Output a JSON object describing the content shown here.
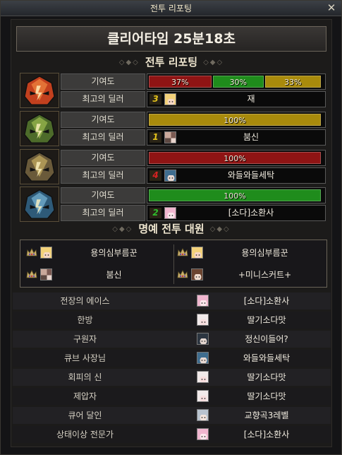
{
  "window": {
    "title": "전투 리포팅",
    "close_icon": "✕"
  },
  "clear_time": "클리어타임  25분18초",
  "report_header": "전투 리포팅",
  "labels": {
    "contribution": "기여도",
    "top_dealer": "최고의 딜러"
  },
  "stages": [
    {
      "icon": "red-helmet-icon",
      "contribution": [
        {
          "label": "37%",
          "value": 37,
          "color": "#8f1414"
        },
        {
          "label": "30%",
          "value": 30,
          "color": "#1f8c1c"
        },
        {
          "label": "33%",
          "value": 33,
          "color": "#a88a0c"
        }
      ],
      "dealer": {
        "rank": "3",
        "rank_color": "#e3c21b",
        "avatar": "blonde-avatar-icon",
        "name": "재"
      }
    },
    {
      "icon": "green-helmet-icon",
      "contribution": [
        {
          "label": "100%",
          "value": 100,
          "color": "#a88a0c"
        }
      ],
      "dealer": {
        "rank": "1",
        "rank_color": "#e3c21b",
        "avatar": "mosaic-avatar-icon",
        "name": "붐신"
      }
    },
    {
      "icon": "gold-helmet-icon",
      "contribution": [
        {
          "label": "100%",
          "value": 100,
          "color": "#8f1414"
        }
      ],
      "dealer": {
        "rank": "4",
        "rank_color": "#d72222",
        "avatar": "blue-hair-avatar-icon",
        "name": "와들와들세탁"
      }
    },
    {
      "icon": "blue-helmet-icon",
      "contribution": [
        {
          "label": "100%",
          "value": 100,
          "color": "#1f8c1c"
        }
      ],
      "dealer": {
        "rank": "2",
        "rank_color": "#2fbd2c",
        "avatar": "pink-hair-avatar-icon",
        "name": "[소다]소환사"
      }
    }
  ],
  "honor_header": "명예 전투 대원",
  "honor_members": [
    {
      "name": "용의심부름꾼",
      "avatar": "blonde-avatar-icon"
    },
    {
      "name": "용의심부름꾼",
      "avatar": "blonde-avatar-icon"
    },
    {
      "name": "붐신",
      "avatar": "mosaic-avatar-icon"
    },
    {
      "name": "+미니스커트+",
      "avatar": "brown-hair-avatar-icon"
    }
  ],
  "awards": [
    {
      "title": "전장의 에이스",
      "name": "[소다]소환사",
      "avatar": "pink-hair-avatar-icon"
    },
    {
      "title": "한방",
      "name": "딸기소다맛",
      "avatar": "white-hair-avatar-icon"
    },
    {
      "title": "구원자",
      "name": "정신이들어?",
      "avatar": "dark-hair-avatar-icon"
    },
    {
      "title": "큐브 사장님",
      "name": "와들와들세탁",
      "avatar": "blue-hair-avatar-icon"
    },
    {
      "title": "회피의 신",
      "name": "딸기소다맛",
      "avatar": "white-hair-avatar-icon"
    },
    {
      "title": "제압자",
      "name": "딸기소다맛",
      "avatar": "white-hair-avatar-icon"
    },
    {
      "title": "큐어 달인",
      "name": "교향곡3레벨",
      "avatar": "silver-hair-avatar-icon"
    },
    {
      "title": "상태이상 전문가",
      "name": "[소다]소환사",
      "avatar": "pink-hair-avatar-icon"
    }
  ],
  "colors": {
    "frame_border": "#6a6458",
    "text": "#efe9dc",
    "gold": "#a88a0c",
    "red": "#8f1414",
    "green": "#1f8c1c"
  }
}
